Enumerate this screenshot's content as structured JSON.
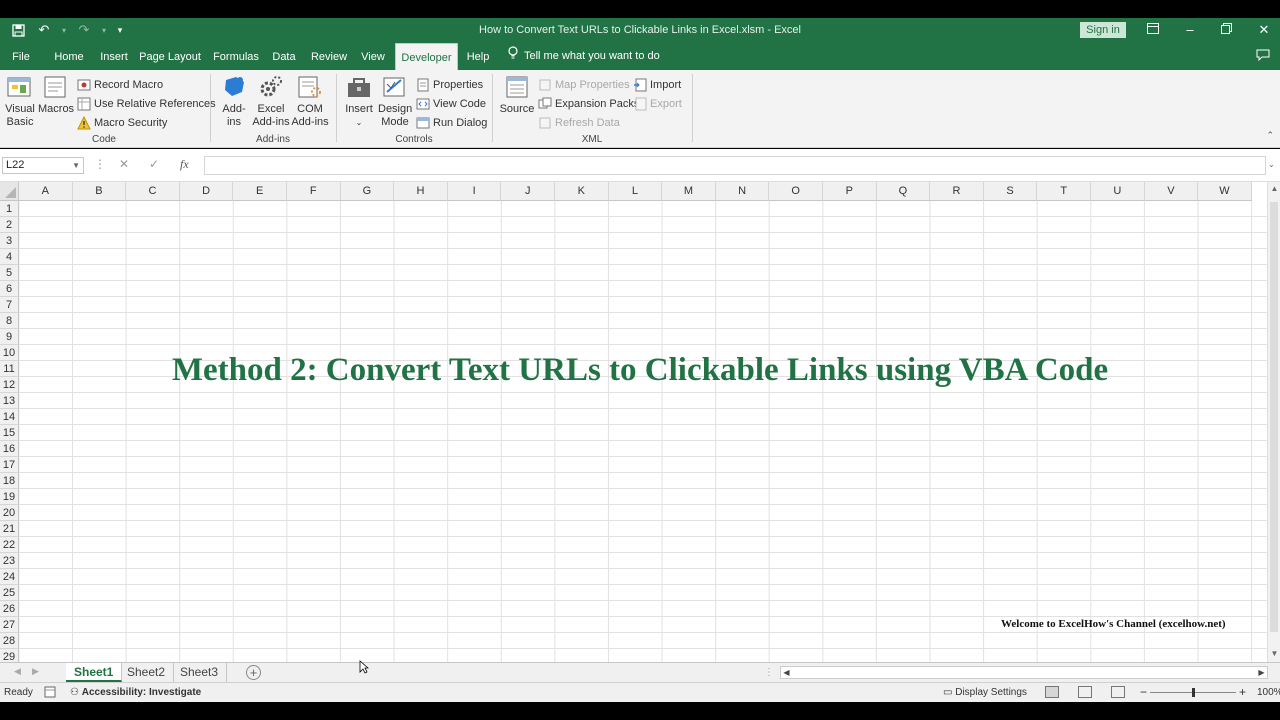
{
  "app": {
    "title": "How to Convert Text URLs to Clickable Links in Excel.xlsm  -  Excel",
    "sign_in": "Sign in"
  },
  "tabs": [
    "File",
    "Home",
    "Insert",
    "Page Layout",
    "Formulas",
    "Data",
    "Review",
    "View",
    "Developer",
    "Help"
  ],
  "active_tab": "Developer",
  "tell_me": "Tell me what you want to do",
  "ribbon": {
    "code": {
      "label": "Code",
      "visual_basic": [
        "Visual",
        "Basic"
      ],
      "macros": "Macros",
      "record_macro": "Record Macro",
      "use_relative": "Use Relative References",
      "macro_security": "Macro Security"
    },
    "addins": {
      "label": "Add-ins",
      "addins_btn": [
        "Add-",
        "ins"
      ],
      "excel_addins": [
        "Excel",
        "Add-ins"
      ],
      "com_addins": [
        "COM",
        "Add-ins"
      ]
    },
    "controls": {
      "label": "Controls",
      "insert": "Insert",
      "design_mode": [
        "Design",
        "Mode"
      ],
      "properties": "Properties",
      "view_code": "View Code",
      "run_dialog": "Run Dialog"
    },
    "xml": {
      "label": "XML",
      "source": "Source",
      "map_properties": "Map Properties",
      "expansion_packs": "Expansion Packs",
      "refresh_data": "Refresh Data",
      "import": "Import",
      "export": "Export"
    }
  },
  "formula_bar": {
    "name_box": "L22",
    "fx": "fx",
    "value": ""
  },
  "columns": [
    "A",
    "B",
    "C",
    "D",
    "E",
    "F",
    "G",
    "H",
    "I",
    "J",
    "K",
    "L",
    "M",
    "N",
    "O",
    "P",
    "Q",
    "R",
    "S",
    "T",
    "U",
    "V",
    "W"
  ],
  "rows": [
    "1",
    "2",
    "3",
    "4",
    "5",
    "6",
    "7",
    "8",
    "9",
    "10",
    "11",
    "12",
    "13",
    "14",
    "15",
    "16",
    "17",
    "18",
    "19",
    "20",
    "21",
    "22",
    "23",
    "24",
    "25",
    "26",
    "27",
    "28",
    "29"
  ],
  "overlay": {
    "headline": "Method 2: Convert Text URLs to Clickable Links using VBA Code",
    "welcome": "Welcome to ExcelHow's  Channel (excelhow.net)"
  },
  "sheets": [
    "Sheet1",
    "Sheet2",
    "Sheet3"
  ],
  "active_sheet": "Sheet1",
  "status": {
    "ready": "Ready",
    "accessibility": "Accessibility: Investigate",
    "display_settings": "Display Settings",
    "zoom": "100%",
    "zoom_minus": "−",
    "zoom_plus": "+"
  },
  "colors": {
    "brand": "#217346"
  }
}
